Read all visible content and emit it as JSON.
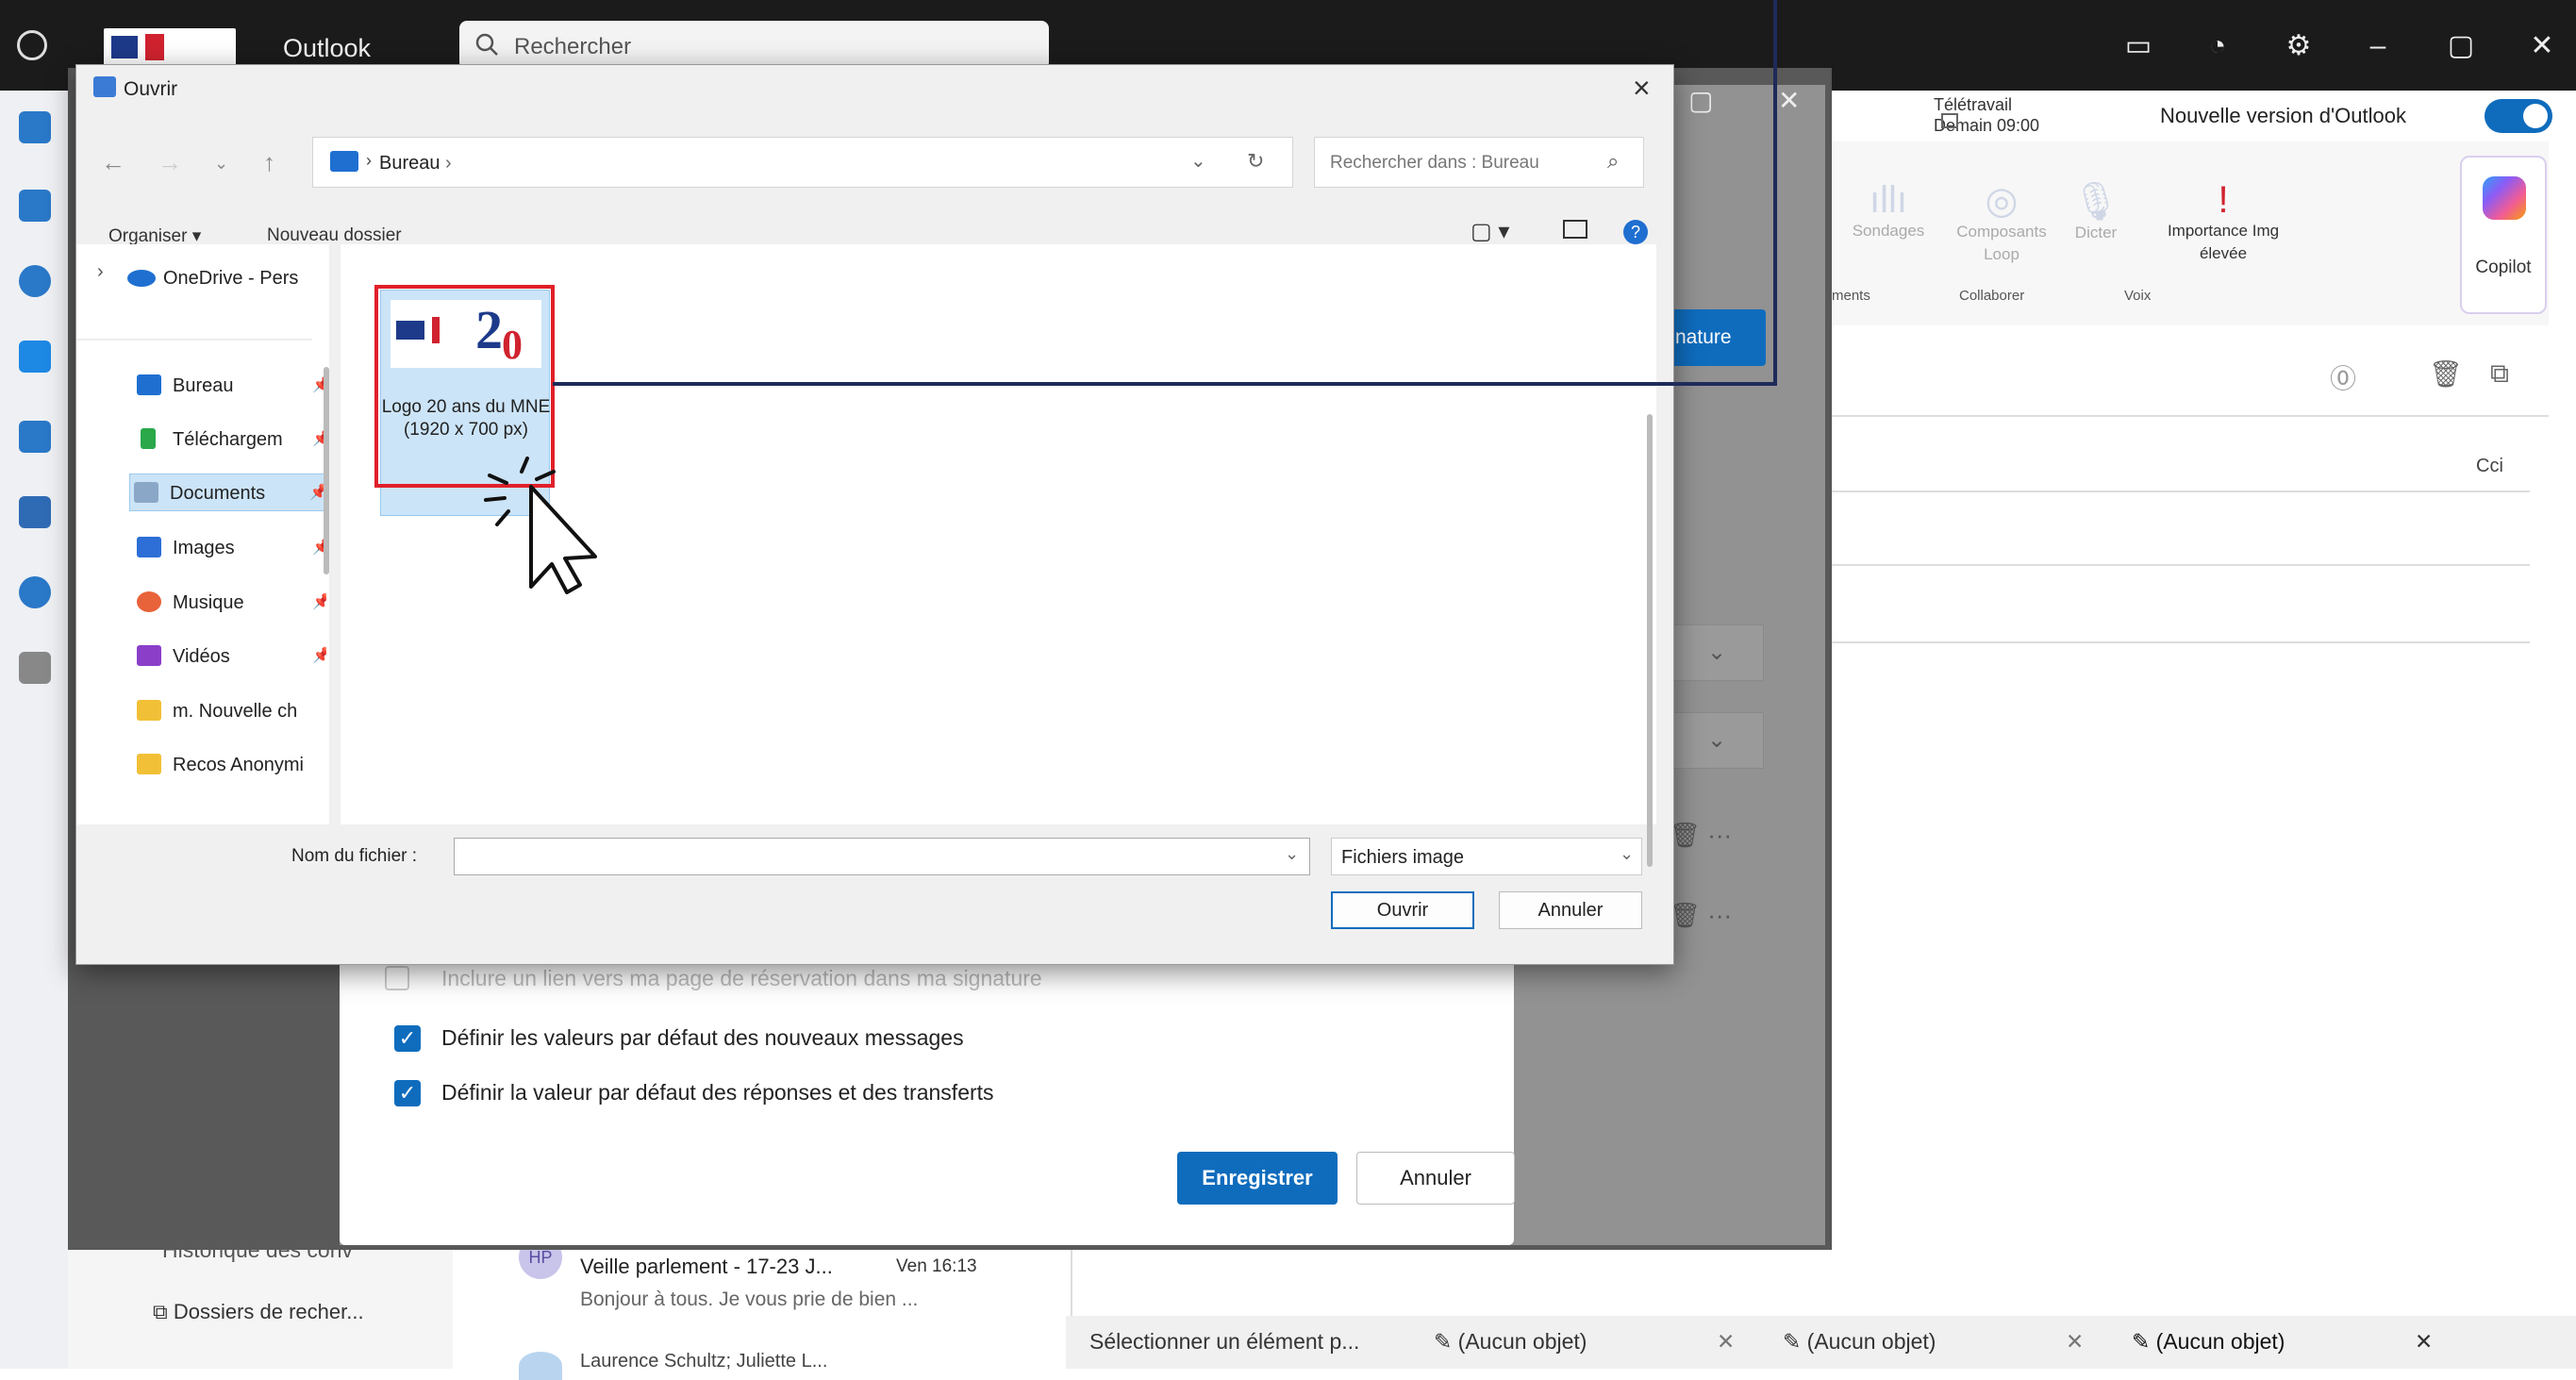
{
  "app": {
    "name": "Outlook"
  },
  "search": {
    "placeholder": "Rechercher"
  },
  "header": {
    "telework_title": "Télétravail",
    "telework_time": "Demain 09:00",
    "new_version_label": "Nouvelle version d'Outlook",
    "new_version_toggle": true
  },
  "ribbon": {
    "polls": "Sondages",
    "loop": "Composants",
    "loop2": "Loop",
    "dictate": "Dicter",
    "importance": "Importance",
    "importance2": "élevée",
    "img": "Img",
    "collaborate": "Collaborer",
    "voice": "Voix",
    "ments": "ments",
    "copilot": "Copilot"
  },
  "compose": {
    "cci": "Cci",
    "signature_btn": "nature"
  },
  "settings": {
    "booking_link": "Inclure un lien vers ma page de réservation dans ma signature",
    "default_new": "Définir les valeurs par défaut des nouveaux messages",
    "default_reply": "Définir la valeur par défaut des réponses et des transferts",
    "save": "Enregistrer",
    "cancel": "Annuler"
  },
  "dialog": {
    "title": "Ouvrir",
    "address": "Bureau",
    "search_placeholder": "Rechercher dans : Bureau",
    "organize": "Organiser",
    "new_folder": "Nouveau dossier",
    "nav_items": [
      {
        "label": "OneDrive - Pers",
        "icon": "cloud-icon"
      },
      {
        "label": "Bureau",
        "icon": "desktop-icon"
      },
      {
        "label": "Téléchargem",
        "icon": "download-icon"
      },
      {
        "label": "Documents",
        "icon": "document-icon"
      },
      {
        "label": "Images",
        "icon": "image-icon"
      },
      {
        "label": "Musique",
        "icon": "music-icon"
      },
      {
        "label": "Vidéos",
        "icon": "video-icon"
      },
      {
        "label": "m. Nouvelle ch",
        "icon": "folder-icon"
      },
      {
        "label": "Recos Anonymi",
        "icon": "folder-icon"
      }
    ],
    "file": {
      "name": "Logo 20 ans du MNE (1920 x 700 px)",
      "thumb_text": "2",
      "thumb_text2": "0"
    },
    "filename_label": "Nom du fichier :",
    "filename_value": "",
    "filetype": "Fichiers image",
    "open": "Ouvrir",
    "cancel": "Annuler"
  },
  "sidebar": {
    "history": "Historique des conv",
    "search_folders": "Dossiers de recher..."
  },
  "mails": [
    {
      "avatar": "HP",
      "sender": "Veille parlement - 17-23 J...",
      "date": "Ven 16:13",
      "preview": "Bonjour à tous. Je vous prie de bien ..."
    },
    {
      "avatar": "",
      "sender": "Laurence Schultz; Juliette L...",
      "date": "",
      "preview": ""
    }
  ],
  "bottom_tabs": [
    {
      "label": "Sélectionner un élément p..."
    },
    {
      "label": "(Aucun objet)"
    },
    {
      "label": "(Aucun objet)"
    },
    {
      "label": "(Aucun objet)"
    }
  ],
  "colors": {
    "accent": "#0f6cbd",
    "highlight": "#e0202a",
    "callout": "#1e2a5a"
  }
}
